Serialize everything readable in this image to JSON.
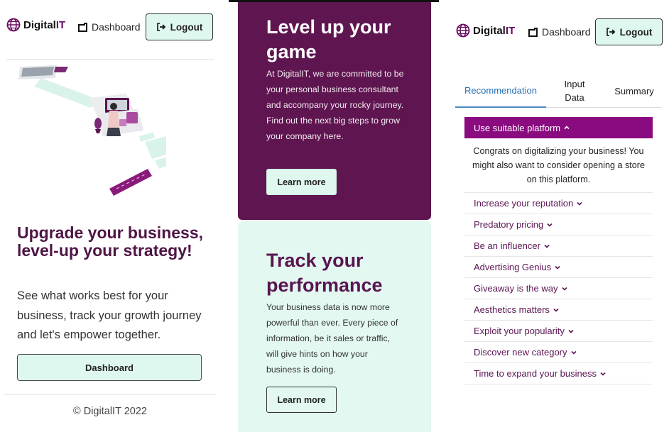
{
  "brand": {
    "name_prefix": "Digital",
    "name_suffix": "IT"
  },
  "nav": {
    "dashboard_label": "Dashboard",
    "logout_label": "Logout"
  },
  "left": {
    "headline": "Upgrade your business, level-up your strategy!",
    "paragraph": "See what works best for your business, track your growth journey and let's empower together.",
    "dashboard_button": "Dashboard",
    "footer": "© DigitalIT 2022"
  },
  "middle": {
    "card1": {
      "title": "Level up your game",
      "body": "At DigitalIT, we are committed to be your personal business consultant and accompany your rocky journey. Find out the next big steps to grow your company here.",
      "button": "Learn more"
    },
    "card2": {
      "title": "Track your performance",
      "body": "Your business data is now more powerful than ever. Every piece of information, be it sales or traffic, will give hints on how your business is doing.",
      "button": "Learn more"
    }
  },
  "right": {
    "tabs": [
      {
        "label": "Recommendation",
        "active": true
      },
      {
        "label": "Input Data",
        "active": false
      },
      {
        "label": "Summary",
        "active": false
      }
    ],
    "open_item": {
      "title": "Use suitable platform",
      "body": "Congrats on digitalizing your business! You might also want to consider opening a store on this platform."
    },
    "items": [
      "Increase your reputation",
      "Predatory pricing",
      "Be an influencer",
      "Advertising Genius",
      "Giveaway is the way",
      "Aesthetics matters",
      "Exploit your popularity",
      "Discover new category",
      "Time to expand your business"
    ]
  },
  "colors": {
    "brand_purple": "#6a0a62",
    "mint": "#dff8ef",
    "accent_blue": "#246fb5",
    "accordion_header": "#8a0a80"
  }
}
